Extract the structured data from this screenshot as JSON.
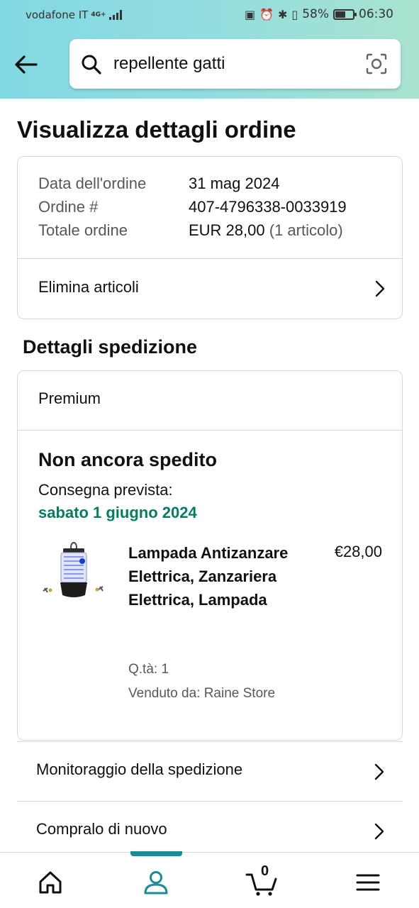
{
  "status_bar": {
    "carrier": "vodafone IT",
    "network": "4G+",
    "battery": "58%",
    "battery_level": 0.58,
    "time": "06:30",
    "icons": [
      "nfc-icon",
      "alarm-icon",
      "bluetooth-icon",
      "vibrate-icon",
      "battery-icon"
    ]
  },
  "search": {
    "query": "repellente gatti"
  },
  "page": {
    "title": "Visualizza dettagli ordine"
  },
  "order_summary": {
    "date_label": "Data dell'ordine",
    "date_value": "31 mag 2024",
    "order_label": "Ordine #",
    "order_value": "407-4796338-0033919",
    "total_label": "Totale ordine",
    "total_value": "EUR 28,00",
    "total_items": "(1 articolo)",
    "remove_items_label": "Elimina articoli"
  },
  "shipment": {
    "section_title": "Dettagli spedizione",
    "service": "Premium",
    "status": "Non ancora spedito",
    "delivery_label": "Consegna prevista:",
    "delivery_date": "sabato 1 giugno 2024",
    "delivery_date_color": "#067d62",
    "product": {
      "title": "Lampada Antizanzare Elettrica, Zanzariera Elettrica, Lampada",
      "price": "€28,00",
      "quantity": "Q.tà: 1",
      "seller": "Venduto da: Raine Store"
    }
  },
  "actions": {
    "track_label": "Monitoraggio della spedizione",
    "buy_again_label": "Compralo di nuovo"
  },
  "bottom_nav": {
    "items": [
      "home-icon",
      "account-icon",
      "cart-icon",
      "menu-icon"
    ],
    "active": "account-icon",
    "cart_count": "0",
    "accent_color": "#1a8c95"
  }
}
